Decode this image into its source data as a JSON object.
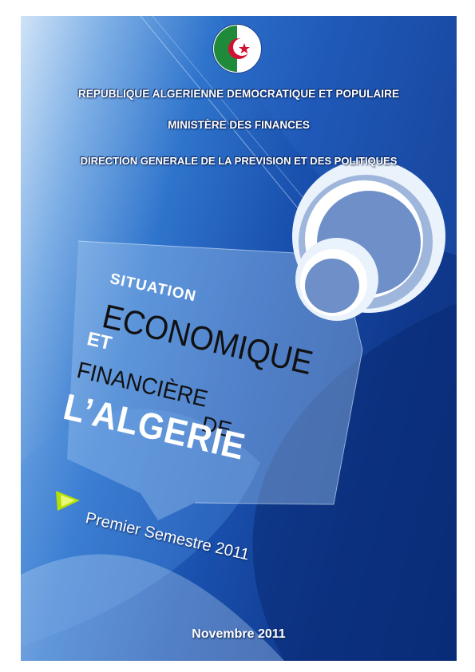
{
  "header": {
    "line1": "REPUBLIQUE ALGERIENNE DEMOCRATIQUE ET POPULAIRE",
    "line2": "MINISTÈRE DES FINANCES",
    "line3": "DIRECTION GENERALE DE LA PREVISION ET DES POLITIQUES"
  },
  "emblem": {
    "icon": "algerian-flag-emblem-icon",
    "colors": {
      "green": "#1f8a3a",
      "white": "#ffffff",
      "red": "#d21034"
    }
  },
  "title": {
    "situation": "SITUATION",
    "economique": "ECONOMIQUE",
    "et": "ET",
    "financiere": "FINANCIÈRE",
    "de": "DE",
    "algerie": "L’ALGERIE"
  },
  "subtitle": {
    "arrow_icon": "play-arrow-icon",
    "text": "Premier Semestre 2011"
  },
  "date": "Novembre 2011",
  "colors": {
    "background_dark": "#0c2f7d",
    "background_light": "#cfe3f7",
    "accent_arrow": "#b6e000"
  }
}
